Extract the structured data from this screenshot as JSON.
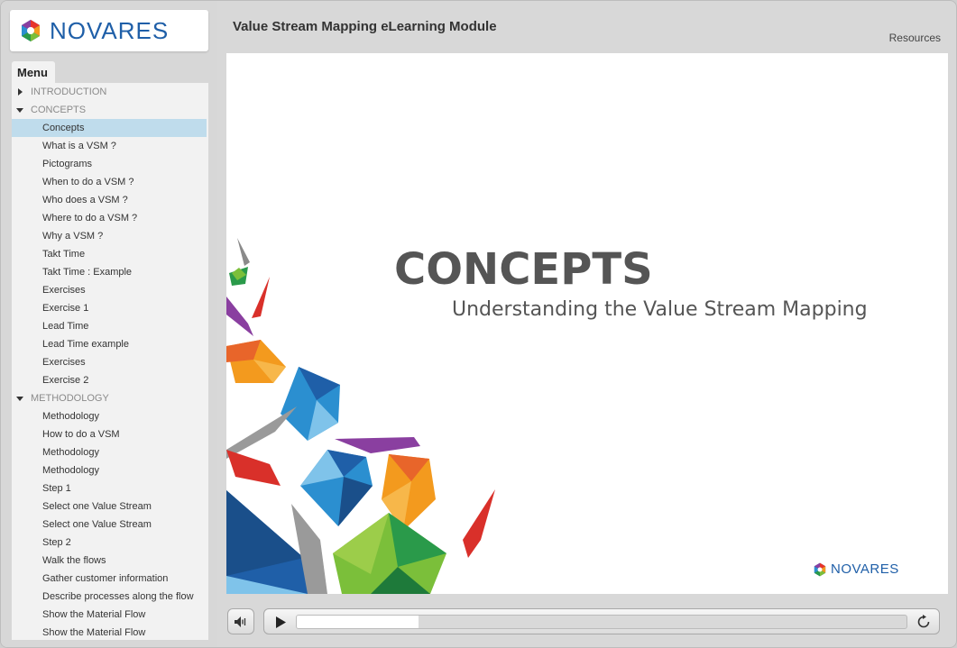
{
  "brand": {
    "logo_text": "NOVARES"
  },
  "header": {
    "title": "Value Stream Mapping eLearning Module",
    "resources_label": "Resources"
  },
  "menu": {
    "tab_label": "Menu",
    "rows": [
      {
        "type": "section",
        "label": "INTRODUCTION",
        "expanded": false
      },
      {
        "type": "section",
        "label": "CONCEPTS",
        "expanded": true
      },
      {
        "type": "item",
        "label": "Concepts",
        "selected": true
      },
      {
        "type": "item",
        "label": "What is a VSM ?"
      },
      {
        "type": "item",
        "label": "Pictograms"
      },
      {
        "type": "item",
        "label": "When to do a VSM ?"
      },
      {
        "type": "item",
        "label": "Who does a VSM ?"
      },
      {
        "type": "item",
        "label": "Where to do a VSM ?"
      },
      {
        "type": "item",
        "label": "Why a VSM ?"
      },
      {
        "type": "item",
        "label": "Takt Time"
      },
      {
        "type": "item",
        "label": "Takt Time : Example"
      },
      {
        "type": "item",
        "label": "Exercises"
      },
      {
        "type": "item",
        "label": "Exercise 1"
      },
      {
        "type": "item",
        "label": "Lead Time"
      },
      {
        "type": "item",
        "label": "Lead Time example"
      },
      {
        "type": "item",
        "label": "Exercises"
      },
      {
        "type": "item",
        "label": "Exercise 2"
      },
      {
        "type": "section",
        "label": "METHODOLOGY",
        "expanded": true
      },
      {
        "type": "item",
        "label": "Methodology"
      },
      {
        "type": "item",
        "label": "How to do a VSM"
      },
      {
        "type": "item",
        "label": "Methodology"
      },
      {
        "type": "item",
        "label": "Methodology"
      },
      {
        "type": "item",
        "label": "Step 1"
      },
      {
        "type": "item",
        "label": "Select one Value Stream"
      },
      {
        "type": "item",
        "label": "Select one Value Stream"
      },
      {
        "type": "item",
        "label": "Step 2"
      },
      {
        "type": "item",
        "label": "Walk the flows"
      },
      {
        "type": "item",
        "label": "Gather customer information"
      },
      {
        "type": "item",
        "label": "Describe processes along the flow"
      },
      {
        "type": "item",
        "label": "Show the Material Flow"
      },
      {
        "type": "item",
        "label": "Show the Material Flow"
      }
    ]
  },
  "slide": {
    "title": "CONCEPTS",
    "subtitle": "Understanding the Value Stream Mapping",
    "logo_text": "NOVARES"
  },
  "controls": {
    "volume_icon": "speaker-icon",
    "play_icon": "play-icon",
    "replay_icon": "replay-icon",
    "progress_fraction": 0.2
  },
  "colors": {
    "brand_blue": "#1f5fa8",
    "selected_row": "#bfdcec"
  }
}
